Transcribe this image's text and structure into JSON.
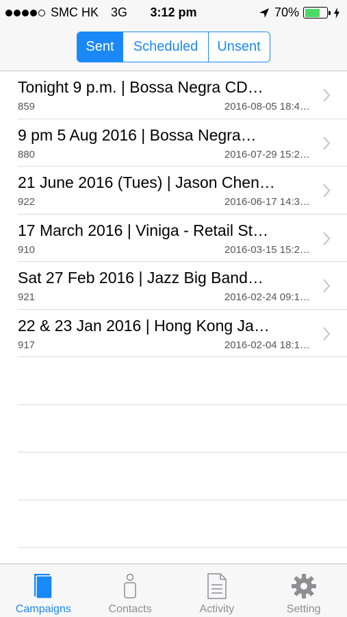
{
  "status_bar": {
    "carrier": "SMC HK",
    "network": "3G",
    "time": "3:12 pm",
    "battery": "70%",
    "battery_level": 0.7,
    "signal_icon": "signal-dots-icon",
    "location_icon": "location-arrow-icon",
    "charging_icon": "bolt-icon"
  },
  "segments": {
    "sent": "Sent",
    "scheduled": "Scheduled",
    "unsent": "Unsent",
    "selected": "Sent"
  },
  "colors": {
    "accent": "#1a88f7",
    "battery": "#4cd964",
    "inactive_tab": "#8e8e93"
  },
  "campaigns": [
    {
      "title": "Tonight 9 p.m. | Bossa Negra CD…",
      "id": "859",
      "date": "2016-08-05 18:4…"
    },
    {
      "title": "9 pm 5 Aug 2016 | Bossa Negra…",
      "id": "880",
      "date": "2016-07-29 15:2…"
    },
    {
      "title": "21 June 2016 (Tues) | Jason Chen…",
      "id": "922",
      "date": "2016-06-17 14:3…"
    },
    {
      "title": "17 March 2016 | Viniga - Retail St…",
      "id": "910",
      "date": "2016-03-15 15:2…"
    },
    {
      "title": "Sat 27 Feb 2016 | Jazz Big Band…",
      "id": "921",
      "date": "2016-02-24 09:1…"
    },
    {
      "title": "22 & 23 Jan 2016 | Hong Kong Ja…",
      "id": "917",
      "date": "2016-02-04 18:1…"
    }
  ],
  "tabs": [
    {
      "label": "Campaigns",
      "icon": "campaigns-icon",
      "active": true
    },
    {
      "label": "Contacts",
      "icon": "contacts-icon",
      "active": false
    },
    {
      "label": "Activity",
      "icon": "activity-icon",
      "active": false
    },
    {
      "label": "Setting",
      "icon": "gear-icon",
      "active": false
    }
  ]
}
